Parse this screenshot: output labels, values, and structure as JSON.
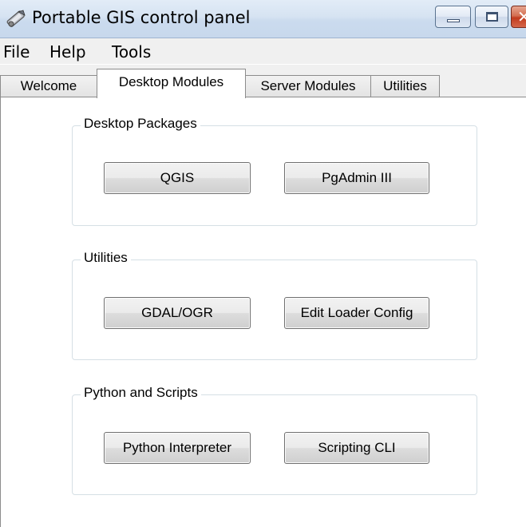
{
  "window": {
    "title": "Portable GIS control panel",
    "controls": {
      "minimize": "minimize",
      "maximize": "maximize",
      "close": "close"
    }
  },
  "menu": [
    {
      "label": "File"
    },
    {
      "label": "Help"
    },
    {
      "label": "Tools"
    }
  ],
  "tabs": [
    {
      "label": "Welcome",
      "active": false
    },
    {
      "label": "Desktop Modules",
      "active": true
    },
    {
      "label": "Server Modules",
      "active": false
    },
    {
      "label": "Utilities",
      "active": false
    }
  ],
  "groups": [
    {
      "title": "Desktop Packages",
      "buttons": [
        "QGIS",
        "PgAdmin III"
      ]
    },
    {
      "title": "Utilities",
      "buttons": [
        "GDAL/OGR",
        "Edit Loader Config"
      ]
    },
    {
      "title": "Python and Scripts",
      "buttons": [
        "Python Interpreter",
        "Scripting CLI"
      ]
    }
  ],
  "icons": {
    "app": "gis-tools-icon",
    "close_glyph": "✕"
  }
}
